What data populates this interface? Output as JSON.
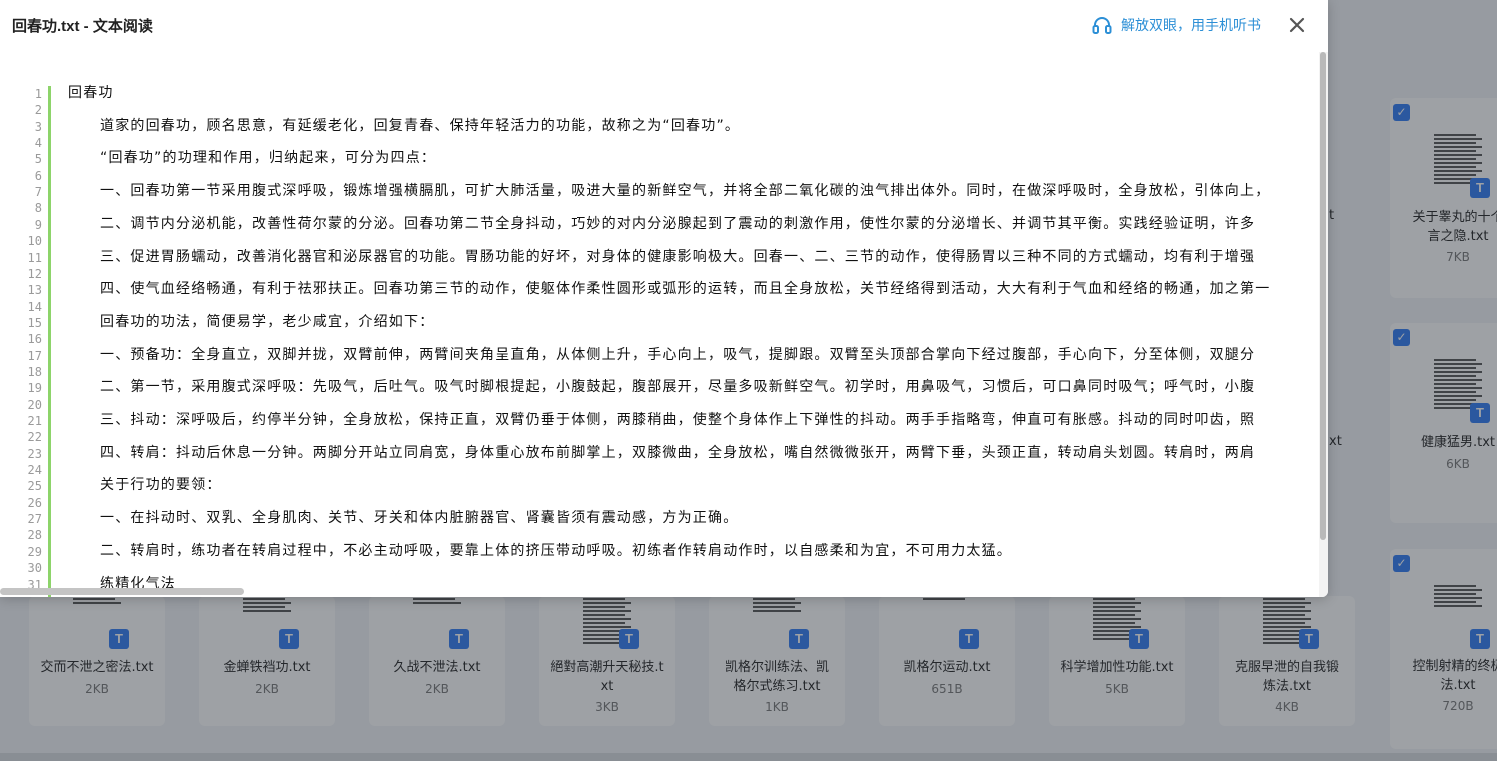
{
  "modal": {
    "title": "回春功.txt - 文本阅读",
    "listen_label": "解放双眼，用手机听书",
    "listen_icon": "headphones-icon",
    "close_icon": "close-icon",
    "accent_color": "#2c8fd6",
    "gutter_color": "#8dd46a"
  },
  "document": {
    "line_numbers": [
      "1",
      "2",
      "3",
      "4",
      "5",
      "6",
      "7",
      "8",
      "9",
      "10",
      "11",
      "12",
      "13",
      "14",
      "15",
      "16",
      "17",
      "18",
      "19",
      "20",
      "21",
      "22",
      "23",
      "24",
      "25",
      "26",
      "27",
      "28",
      "29",
      "30",
      "31"
    ],
    "lines": [
      "回春功",
      "道家的回春功，顾名思意，有延缓老化，回复青春、保持年轻活力的功能，故称之为“回春功”。",
      "“回春功”的功理和作用，归纳起来，可分为四点：",
      "一、回春功第一节采用腹式深呼吸，锻炼增强横膈肌，可扩大肺活量，吸进大量的新鲜空气，并将全部二氧化碳的浊气排出体外。同时，在做深呼吸时，全身放松，引体向上，",
      "二、调节内分泌机能，改善性荷尔蒙的分泌。回春功第二节全身抖动，巧妙的对内分泌腺起到了震动的刺激作用，使性尔蒙的分泌增长、并调节其平衡。实践经验证明，许多",
      "三、促进胃肠蠕动，改善消化器官和泌尿器官的功能。胃肠功能的好坏，对身体的健康影响极大。回春一、二、三节的动作，使得肠胃以三种不同的方式蠕动，均有利于增强",
      "四、使气血经络畅通，有利于祛邪扶正。回春功第三节的动作，使躯体作柔性圆形或弧形的运转，而且全身放松，关节经络得到活动，大大有利于气血和经络的畅通，加之第一",
      "回春功的功法，简便易学，老少咸宜，介绍如下：",
      "一、预备功：全身直立，双脚并拢，双臂前伸，两臂间夹角呈直角，从体侧上升，手心向上，吸气，提脚跟。双臂至头顶部合掌向下经过腹部，手心向下，分至体侧，双腿分",
      "二、第一节，采用腹式深呼吸：先吸气，后吐气。吸气时脚根提起，小腹鼓起，腹部展开，尽量多吸新鲜空气。初学时，用鼻吸气，习惯后，可口鼻同时吸气；呼气时，小腹",
      "三、抖动：深呼吸后，约停半分钟，全身放松，保持正直，双臂仍垂于体侧，两膝稍曲，使整个身体作上下弹性的抖动。两手手指略弯，伸直可有胀感。抖动的同时叩齿，照",
      "四、转肩：抖动后休息一分钟。两脚分开站立同肩宽，身体重心放布前脚掌上，双膝微曲，全身放松，嘴自然微微张开，两臂下垂，头颈正直，转动肩头划圆。转肩时，两肩",
      "关于行功的要领：",
      "一、在抖动时、双乳、全身肌肉、关节、牙关和体内脏腑器官、肾囊皆须有震动感，方为正确。",
      "二、转肩时，练功者在转肩过程中，不必主动呼吸，要靠上体的挤压带动呼吸。初练者作转肩动作时，以自感柔和为宜，不可用力太猛。",
      "练精化气法"
    ]
  },
  "background": {
    "right_column": [
      {
        "name": "关于睾丸的十个\n言之隐.txt",
        "size": "7KB",
        "peek": "t"
      },
      {
        "name": "健康猛男.txt",
        "size": "6KB",
        "peek": "xt"
      },
      {
        "name": "控制射精的终极\n法.txt",
        "size": "720B",
        "peek": ""
      }
    ],
    "bottom_row": [
      {
        "name": "交而不泄之密法.txt",
        "size": "2KB"
      },
      {
        "name": "金蝉铁裆功.txt",
        "size": "2KB"
      },
      {
        "name": "久战不泄法.txt",
        "size": "2KB"
      },
      {
        "name": "絕對高潮升天秘技.t\nxt",
        "size": "3KB"
      },
      {
        "name": "凯格尔训练法、凯\n格尔式练习.txt",
        "size": "1KB"
      },
      {
        "name": "凯格尔运动.txt",
        "size": "651B"
      },
      {
        "name": "科学增加性功能.txt",
        "size": "5KB"
      },
      {
        "name": "克服早泄的自我锻\n炼法.txt",
        "size": "4KB"
      }
    ],
    "type_badge": "T",
    "check_mark": "✓"
  }
}
